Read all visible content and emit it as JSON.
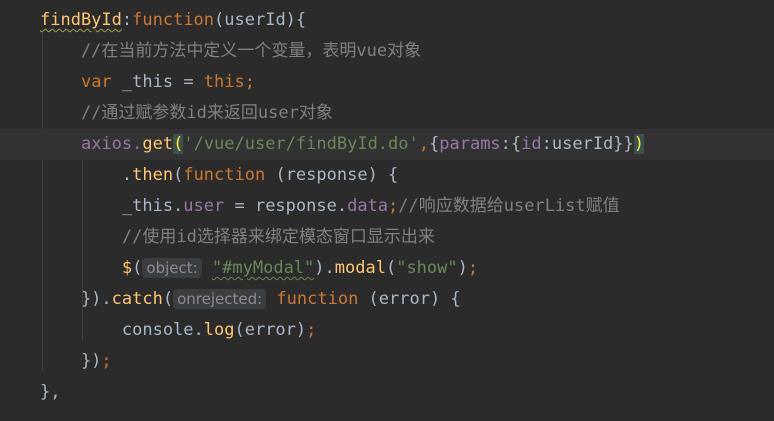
{
  "colors": {
    "background": "#2b2b2b",
    "current_line": "#323232",
    "keyword": "#cc7832",
    "plain": "#a9b7c6",
    "function_name": "#ffc66d",
    "property": "#9876aa",
    "string": "#6a8759",
    "comment": "#808080",
    "brace_match": "#3b514d"
  },
  "lines": [
    {
      "current": false,
      "tokens": [
        {
          "t": "findById",
          "c": "fn uw"
        },
        {
          "t": ":",
          "c": "pl"
        },
        {
          "t": "function",
          "c": "k"
        },
        {
          "t": "(userId){",
          "c": "pl"
        }
      ]
    },
    {
      "current": false,
      "tokens": [
        {
          "t": "    //在当前方法中定义一个变量，表明vue对象",
          "c": "cm"
        }
      ]
    },
    {
      "current": false,
      "tokens": [
        {
          "t": "    ",
          "c": "pl"
        },
        {
          "t": "var",
          "c": "k"
        },
        {
          "t": " _this = ",
          "c": "pl"
        },
        {
          "t": "this;",
          "c": "k"
        }
      ]
    },
    {
      "current": false,
      "tokens": [
        {
          "t": "    //通过赋参数id来返回user对象",
          "c": "cm"
        }
      ]
    },
    {
      "current": true,
      "tokens": [
        {
          "t": "    ",
          "c": "pl"
        },
        {
          "t": "axios.",
          "c": "pr"
        },
        {
          "t": "get",
          "c": "fn"
        },
        {
          "t": "(",
          "c": "bm"
        },
        {
          "t": "'/vue/user/findById.do'",
          "c": "st"
        },
        {
          "t": ",",
          "c": "p"
        },
        {
          "t": "{",
          "c": "pl"
        },
        {
          "t": "params",
          "c": "pr"
        },
        {
          "t": ":{",
          "c": "pl"
        },
        {
          "t": "id",
          "c": "pr"
        },
        {
          "t": ":userId}}",
          "c": "pl"
        },
        {
          "t": ")",
          "c": "bm"
        }
      ]
    },
    {
      "current": false,
      "tokens": [
        {
          "t": "        .",
          "c": "pl"
        },
        {
          "t": "then",
          "c": "fn"
        },
        {
          "t": "(",
          "c": "pl"
        },
        {
          "t": "function",
          "c": "k"
        },
        {
          "t": " (response) {",
          "c": "pl"
        }
      ]
    },
    {
      "current": false,
      "tokens": [
        {
          "t": "        _this.",
          "c": "pl"
        },
        {
          "t": "user",
          "c": "pr"
        },
        {
          "t": " = response.",
          "c": "pl"
        },
        {
          "t": "data",
          "c": "pr"
        },
        {
          "t": ";",
          "c": "p"
        },
        {
          "t": "//响应数据给userList赋值",
          "c": "cm"
        }
      ]
    },
    {
      "current": false,
      "tokens": [
        {
          "t": "        //使用id选择器来绑定模态窗口显示出来",
          "c": "cm"
        }
      ]
    },
    {
      "current": false,
      "tokens": [
        {
          "t": "        ",
          "c": "pl"
        },
        {
          "t": "$",
          "c": "fn"
        },
        {
          "t": "(",
          "c": "pl"
        },
        {
          "t": "object:",
          "c": "hint"
        },
        {
          "t": " ",
          "c": "pl"
        },
        {
          "t": "\"#myModal\"",
          "c": "st ow"
        },
        {
          "t": ").",
          "c": "pl"
        },
        {
          "t": "modal",
          "c": "fn"
        },
        {
          "t": "(",
          "c": "pl"
        },
        {
          "t": "\"show\"",
          "c": "st"
        },
        {
          "t": ")",
          "c": "pl"
        },
        {
          "t": ";",
          "c": "p"
        }
      ]
    },
    {
      "current": false,
      "tokens": [
        {
          "t": "    }).",
          "c": "pl"
        },
        {
          "t": "catch",
          "c": "fn"
        },
        {
          "t": "(",
          "c": "pl"
        },
        {
          "t": "onrejected:",
          "c": "hint"
        },
        {
          "t": " ",
          "c": "pl"
        },
        {
          "t": "function",
          "c": "k"
        },
        {
          "t": " (error) {",
          "c": "pl"
        }
      ]
    },
    {
      "current": false,
      "tokens": [
        {
          "t": "        console.",
          "c": "pl"
        },
        {
          "t": "log",
          "c": "fn"
        },
        {
          "t": "(error)",
          "c": "pl"
        },
        {
          "t": ";",
          "c": "p"
        }
      ]
    },
    {
      "current": false,
      "tokens": [
        {
          "t": "    })",
          "c": "pl"
        },
        {
          "t": ";",
          "c": "p"
        }
      ]
    },
    {
      "current": false,
      "tokens": [
        {
          "t": "},",
          "c": "pl"
        }
      ]
    }
  ]
}
